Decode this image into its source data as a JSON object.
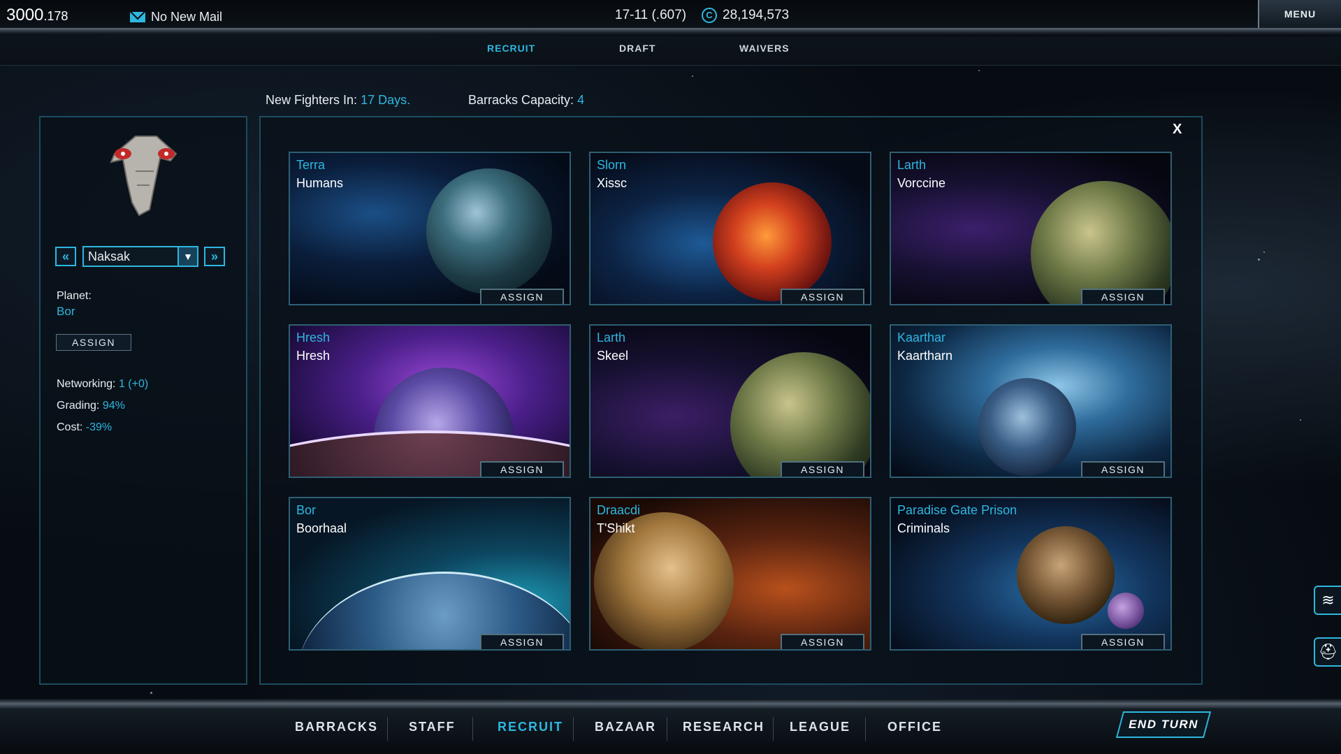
{
  "topbar": {
    "credits_main": "3000",
    "credits_decimal": ".178",
    "mail": "No New Mail",
    "record": "17-11 (.607)",
    "money": "28,194,573",
    "menu": "MENU",
    "coin_glyph": "C"
  },
  "subtabs": [
    {
      "label": "RECRUIT",
      "active": true
    },
    {
      "label": "DRAFT",
      "active": false
    },
    {
      "label": "WAIVERS",
      "active": false
    }
  ],
  "info": {
    "new_fighters_label": "New Fighters In:",
    "new_fighters_value": "17 Days.",
    "capacity_label": "Barracks Capacity:",
    "capacity_value": "4"
  },
  "scout": {
    "selected": "Naksak",
    "prev_glyph": "«",
    "next_glyph": "»",
    "dropdown_glyph": "▼",
    "planet_label": "Planet:",
    "planet_value": "Bor",
    "assign_label": "ASSIGN",
    "networking_label": "Networking:",
    "networking_value": "1 (+0)",
    "grading_label": "Grading:",
    "grading_value": "94%",
    "cost_label": "Cost:",
    "cost_value": "-39%"
  },
  "close_label": "X",
  "planets": [
    {
      "name": "Terra",
      "race": "Humans",
      "assign": "ASSIGN"
    },
    {
      "name": "Slorn",
      "race": "Xissc",
      "assign": "ASSIGN"
    },
    {
      "name": "Larth",
      "race": "Vorccine",
      "assign": "ASSIGN"
    },
    {
      "name": "Hresh",
      "race": "Hresh",
      "assign": "ASSIGN"
    },
    {
      "name": "Larth",
      "race": "Skeel",
      "assign": "ASSIGN"
    },
    {
      "name": "Kaarthar",
      "race": "Kaartharn",
      "assign": "ASSIGN"
    },
    {
      "name": "Bor",
      "race": "Boorhaal",
      "assign": "ASSIGN"
    },
    {
      "name": "Draacdi",
      "race": "T'Shikt",
      "assign": "ASSIGN"
    },
    {
      "name": "Paradise Gate Prison",
      "race": "Criminals",
      "assign": "ASSIGN"
    }
  ],
  "bottom_nav": [
    {
      "label": "BARRACKS",
      "active": false
    },
    {
      "label": "STAFF",
      "active": false
    },
    {
      "label": "RECRUIT",
      "active": true
    },
    {
      "label": "BAZAAR",
      "active": false
    },
    {
      "label": "RESEARCH",
      "active": false
    },
    {
      "label": "LEAGUE",
      "active": false
    },
    {
      "label": "OFFICE",
      "active": false
    }
  ],
  "end_turn": "END TURN",
  "side_icons": [
    "signal-icon",
    "helmet-icon"
  ],
  "side_glyphs": [
    "≋",
    "⛑"
  ],
  "colors": {
    "accent": "#2eb7e0",
    "panel_border": "#1d4c5f"
  }
}
